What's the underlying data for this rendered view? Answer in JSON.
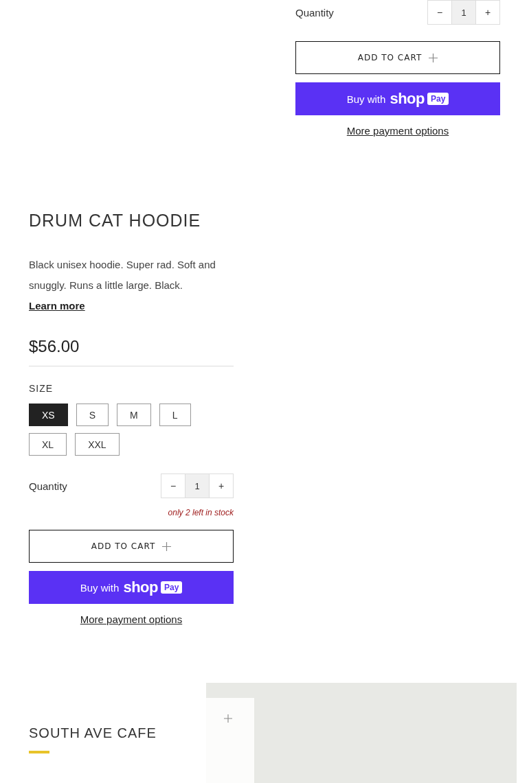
{
  "top_product": {
    "quantity_label": "Quantity",
    "quantity": {
      "decrement": "−",
      "value": "1",
      "increment": "+"
    },
    "add_to_cart": "ADD TO CART",
    "buy_button": {
      "prefix": "Buy with",
      "logo_word": "shop",
      "logo_badge": "Pay"
    },
    "more_payment": "More payment options"
  },
  "product": {
    "title": "DRUM CAT HOODIE",
    "description": "Black unisex hoodie. Super rad. Soft and snuggly. Runs a little large. Black.",
    "link": "Learn more",
    "price": "$56.00",
    "option_label": "SIZE",
    "sizes": [
      {
        "label": "XS",
        "selected": true
      },
      {
        "label": "S",
        "selected": false
      },
      {
        "label": "M",
        "selected": false
      },
      {
        "label": "L",
        "selected": false
      },
      {
        "label": "XL",
        "selected": false
      },
      {
        "label": "XXL",
        "selected": false
      }
    ],
    "quantity_label": "Quantity",
    "quantity": {
      "decrement": "−",
      "value": "1",
      "increment": "+"
    },
    "stock_note": "only 2 left in stock",
    "add_to_cart": "ADD TO CART",
    "buy_button": {
      "prefix": "Buy with",
      "logo_word": "shop",
      "logo_badge": "Pay"
    },
    "more_payment": "More payment options"
  },
  "location": {
    "title": "SOUTH AVE CAFE"
  }
}
